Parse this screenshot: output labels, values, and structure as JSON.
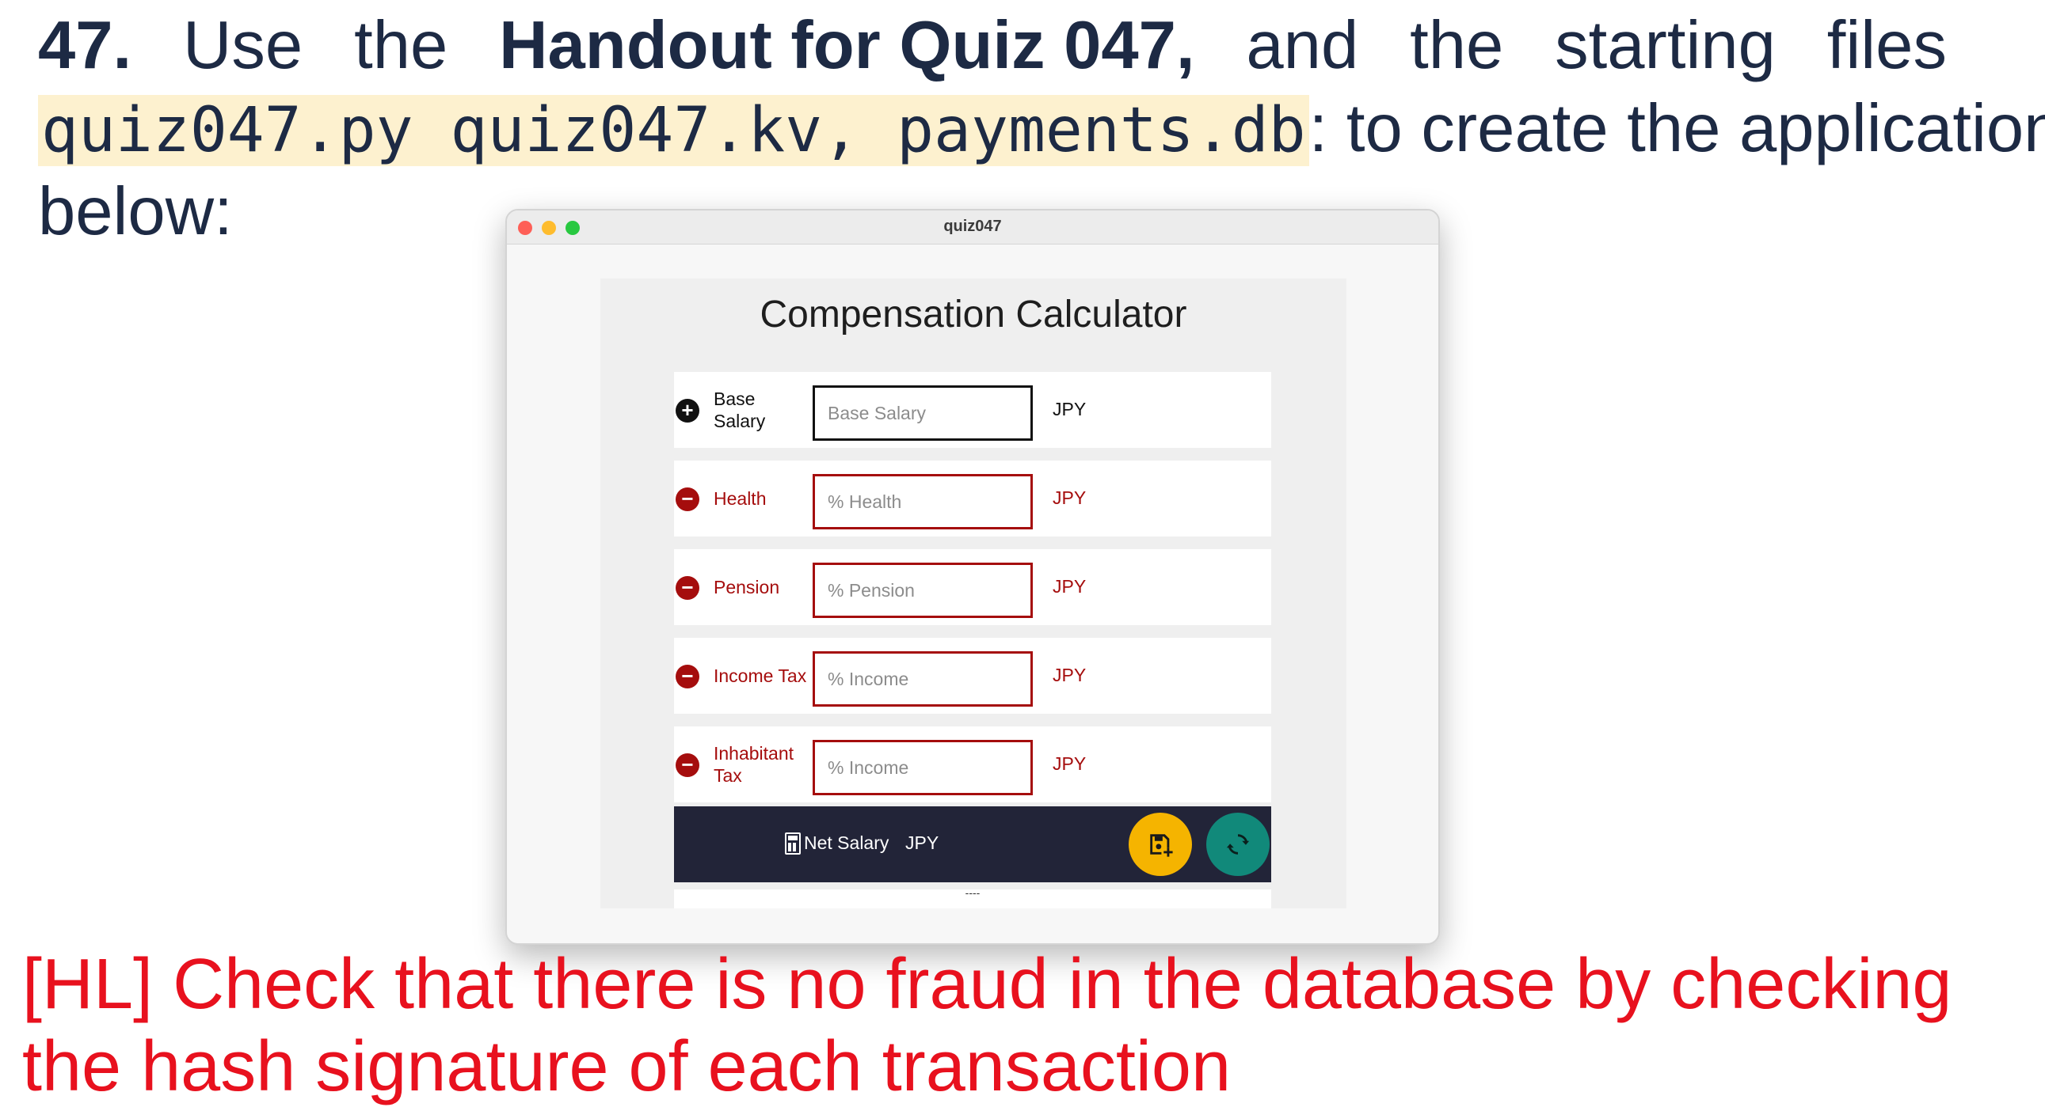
{
  "question": {
    "number": "47.",
    "line1_words": [
      "Use",
      "the"
    ],
    "handout": "Handout for Quiz 047",
    "line1_tail": [
      ",",
      "and",
      "the",
      "starting",
      "files"
    ],
    "files": "quiz047.py quiz047.kv, payments.db",
    "line2_tail": ": to create the application",
    "line3": "below:"
  },
  "note": "[HL] Check that there is no fraud in the database by checking the hash signature of each transaction",
  "window": {
    "title": "quiz047",
    "app_title": "Compensation Calculator",
    "rows": [
      {
        "icon": "+",
        "label": "Base Salary",
        "placeholder": "Base Salary",
        "unit": "JPY",
        "kind": "plus"
      },
      {
        "icon": "−",
        "label": "Health",
        "placeholder": "% Health",
        "unit": "JPY",
        "kind": "minus"
      },
      {
        "icon": "−",
        "label": "Pension",
        "placeholder": "% Pension",
        "unit": "JPY",
        "kind": "minus"
      },
      {
        "icon": "−",
        "label": "Income Tax",
        "placeholder": "% Income",
        "unit": "JPY",
        "kind": "minus"
      },
      {
        "icon": "−",
        "label": "Inhabitant Tax",
        "placeholder": "%  Income",
        "unit": "JPY",
        "kind": "minus"
      }
    ],
    "net": {
      "label": "Net Salary",
      "unit": "JPY",
      "icon": "calculator-icon"
    },
    "buttons": {
      "save_icon": "save-plus-icon",
      "refresh_icon": "refresh-icon",
      "save_color": "#f5b400",
      "refresh_color": "#11897a"
    },
    "bottom_text": "----"
  },
  "colors": {
    "text_dark": "#1d2a44",
    "highlight": "#fdf1cf",
    "note_red": "#e8111e",
    "deduction_red": "#a50d0d",
    "net_bar": "#222438"
  }
}
